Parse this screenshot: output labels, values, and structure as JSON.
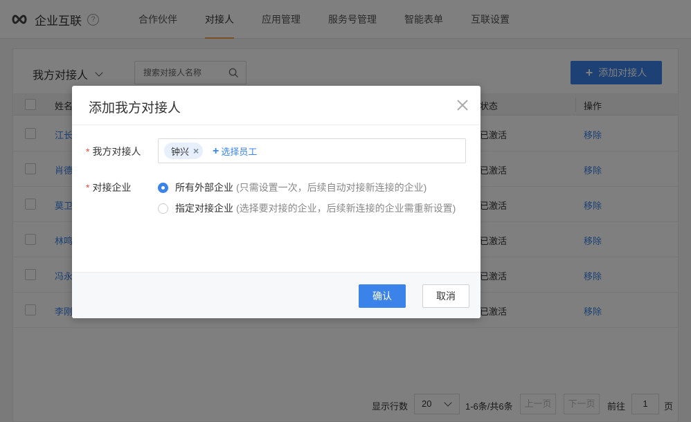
{
  "app": {
    "title": "企业互联",
    "help": "?"
  },
  "nav": {
    "tabs": [
      {
        "label": "合作伙伴"
      },
      {
        "label": "对接人",
        "active": true
      },
      {
        "label": "应用管理"
      },
      {
        "label": "服务号管理"
      },
      {
        "label": "智能表单"
      },
      {
        "label": "互联设置"
      }
    ]
  },
  "toolbar": {
    "filter_label": "我方对接人",
    "search_placeholder": "搜索对接人名称",
    "add_label": "添加对接人"
  },
  "table": {
    "headers": {
      "name": "姓名",
      "status": "状态",
      "op": "操作"
    },
    "rows": [
      {
        "name": "江长",
        "status": "已激活",
        "op": "移除"
      },
      {
        "name": "肖德",
        "status": "已激活",
        "op": "移除"
      },
      {
        "name": "莫卫",
        "status": "已激活",
        "op": "移除"
      },
      {
        "name": "林鸣",
        "status": "已激活",
        "op": "移除"
      },
      {
        "name": "冯永",
        "status": "已激活",
        "op": "移除"
      },
      {
        "name": "李刚",
        "status": "已激活",
        "op": "移除"
      }
    ]
  },
  "pager": {
    "rows_label": "显示行数",
    "page_size": "20",
    "info": "1-6条/共6条",
    "prev": "上一页",
    "next": "下一页",
    "goto": "前往",
    "page": "1",
    "page_suffix": "页"
  },
  "modal": {
    "title": "添加我方对接人",
    "contact_label": "我方对接人",
    "selected_tag": "钟兴",
    "pick_link": "选择员工",
    "enterprise_label": "对接企业",
    "options": [
      {
        "label": "所有外部企业",
        "hint": "(只需设置一次，后续自动对接新连接的企业)",
        "checked": true
      },
      {
        "label": "指定对接企业",
        "hint": "(选择要对接的企业，后续新连接的企业需重新设置)",
        "checked": false
      }
    ],
    "ok": "确认",
    "cancel": "取消"
  },
  "colors": {
    "accent": "#3b83e8",
    "tab_underline": "#f0a04b",
    "required": "#e24b3b"
  }
}
